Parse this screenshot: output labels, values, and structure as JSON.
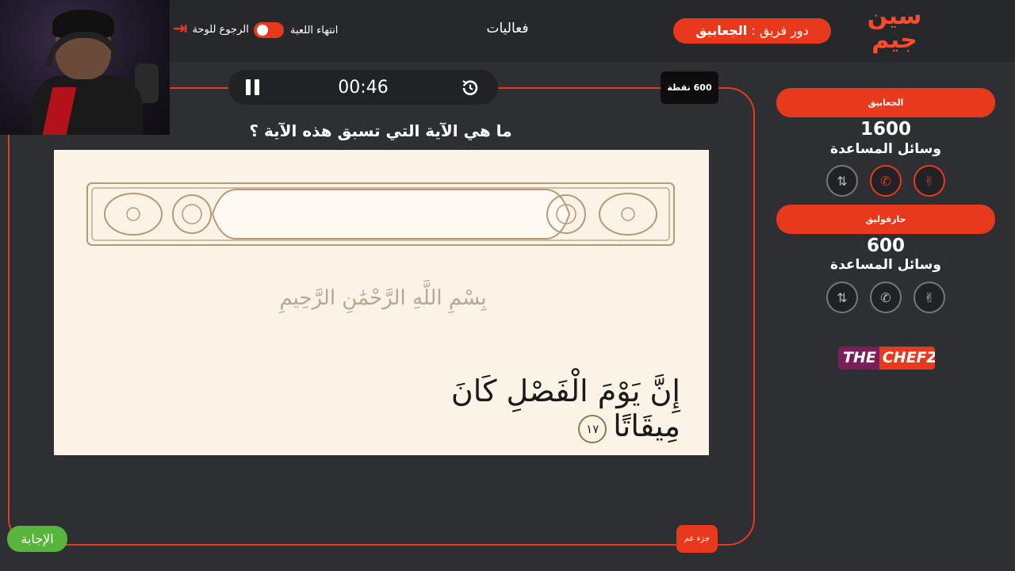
{
  "header": {
    "logo_line1": "سين",
    "logo_line2": "جيم",
    "turn_prefix": "دور فريق : ",
    "turn_team": "الجعابيق",
    "title": "فعاليات",
    "end_game": "انتهاء اللعبة",
    "back_to_board": "الرجوع للوحة"
  },
  "question": {
    "timer": "00:46",
    "points": "600 نقطة",
    "text": "ما هي الآية التي تسبق هذه الآية ؟",
    "basmala": "بِسْمِ اللَّهِ الرَّحْمَٰنِ الرَّحِيمِ",
    "ayah": "إِنَّ يَوْمَ الْفَصْلِ كَانَ مِيقَاتًا",
    "ayah_number": "١٧",
    "answer_button": "الإجابة",
    "category_button": "جزء عم"
  },
  "teams": [
    {
      "name": "الجعابيق",
      "score": "1600",
      "aids_label": "وسائل المساعدة",
      "aids": [
        {
          "icon": "swap-icon",
          "active": false
        },
        {
          "icon": "phone-icon",
          "active": true
        },
        {
          "icon": "peace-hand-icon",
          "active": true
        }
      ]
    },
    {
      "name": "حارفوليق",
      "score": "600",
      "aids_label": "وسائل المساعدة",
      "aids": [
        {
          "icon": "swap-icon",
          "active": false
        },
        {
          "icon": "phone-icon",
          "active": false
        },
        {
          "icon": "peace-hand-icon",
          "active": false
        }
      ]
    }
  ],
  "sponsor": {
    "part1": "THE",
    "part2": "CHEFZ"
  },
  "colors": {
    "accent": "#e8391c",
    "background": "#2d2f33",
    "answer_green": "#58b53c",
    "page_paper": "#fbf3e6"
  }
}
